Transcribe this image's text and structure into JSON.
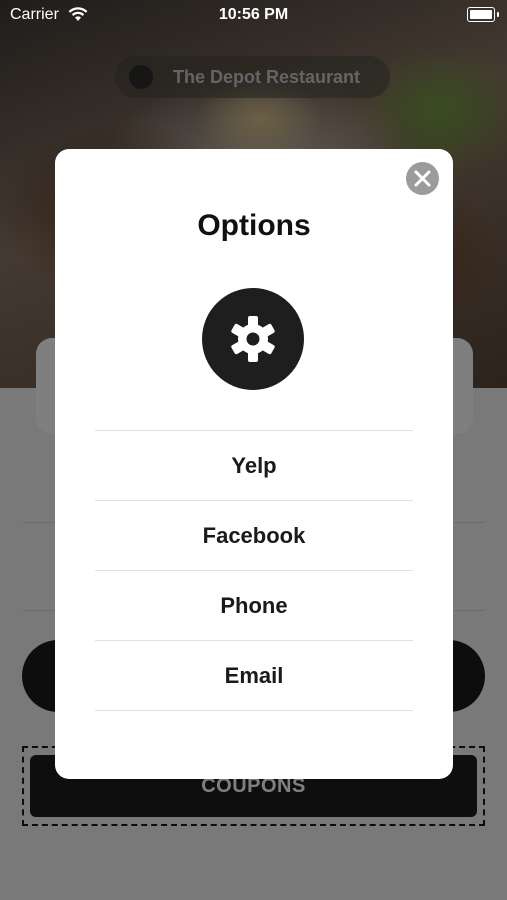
{
  "status_bar": {
    "carrier": "Carrier",
    "time": "10:56 PM"
  },
  "background": {
    "restaurant_name": "The Depot Restaurant",
    "coupons_label": "COUPONS"
  },
  "modal": {
    "title": "Options",
    "options": [
      {
        "label": "Yelp"
      },
      {
        "label": "Facebook"
      },
      {
        "label": "Phone"
      },
      {
        "label": "Email"
      }
    ]
  },
  "colors": {
    "modal_bg": "#ffffff",
    "gear_badge": "#1e1e1e",
    "close_button": "#9b9b9b",
    "scrim": "rgba(0,0,0,0.5)"
  }
}
